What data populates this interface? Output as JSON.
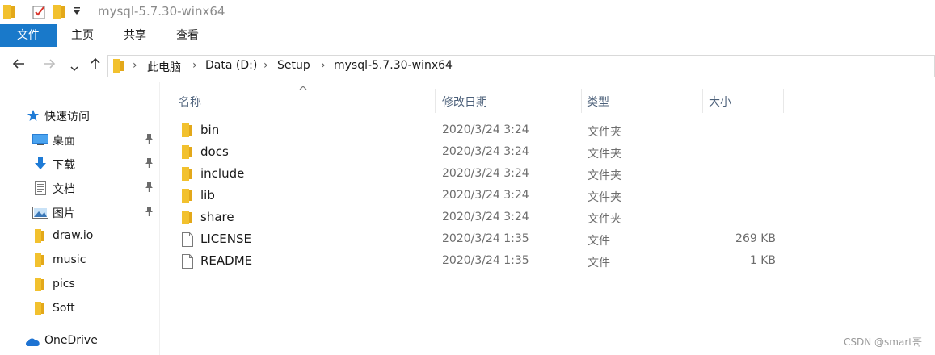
{
  "window": {
    "title": "mysql-5.7.30-winx64"
  },
  "ribbon": {
    "tabs": [
      "文件",
      "主页",
      "共享",
      "查看"
    ]
  },
  "breadcrumb": [
    "此电脑",
    "Data (D:)",
    "Setup",
    "mysql-5.7.30-winx64"
  ],
  "sidebar": {
    "quick_access": {
      "label": "快速访问",
      "icon": "star-icon"
    },
    "items": [
      {
        "label": "桌面",
        "icon": "desktop-icon",
        "pinned": true
      },
      {
        "label": "下载",
        "icon": "download-icon",
        "pinned": true
      },
      {
        "label": "文档",
        "icon": "document-icon",
        "pinned": true
      },
      {
        "label": "图片",
        "icon": "picture-icon",
        "pinned": true
      },
      {
        "label": "draw.io",
        "icon": "folder-icon",
        "pinned": false
      },
      {
        "label": "music",
        "icon": "folder-icon",
        "pinned": false
      },
      {
        "label": "pics",
        "icon": "folder-icon",
        "pinned": false
      },
      {
        "label": "Soft",
        "icon": "folder-icon",
        "pinned": false
      }
    ],
    "onedrive": {
      "label": "OneDrive",
      "icon": "cloud-icon"
    }
  },
  "columns": {
    "name": "名称",
    "date": "修改日期",
    "type": "类型",
    "size": "大小"
  },
  "files": [
    {
      "name": "bin",
      "date": "2020/3/24 3:24",
      "type": "文件夹",
      "size": "",
      "icon": "folder-icon"
    },
    {
      "name": "docs",
      "date": "2020/3/24 3:24",
      "type": "文件夹",
      "size": "",
      "icon": "folder-icon"
    },
    {
      "name": "include",
      "date": "2020/3/24 3:24",
      "type": "文件夹",
      "size": "",
      "icon": "folder-icon"
    },
    {
      "name": "lib",
      "date": "2020/3/24 3:24",
      "type": "文件夹",
      "size": "",
      "icon": "folder-icon"
    },
    {
      "name": "share",
      "date": "2020/3/24 3:24",
      "type": "文件夹",
      "size": "",
      "icon": "folder-icon"
    },
    {
      "name": "LICENSE",
      "date": "2020/3/24 1:35",
      "type": "文件",
      "size": "269 KB",
      "icon": "file-icon"
    },
    {
      "name": "README",
      "date": "2020/3/24 1:35",
      "type": "文件",
      "size": "1 KB",
      "icon": "file-icon"
    }
  ],
  "watermark": "CSDN @smart哥",
  "colors": {
    "accent": "#1979ca",
    "folder": "#f2c12e",
    "header_text": "#4c607a"
  }
}
